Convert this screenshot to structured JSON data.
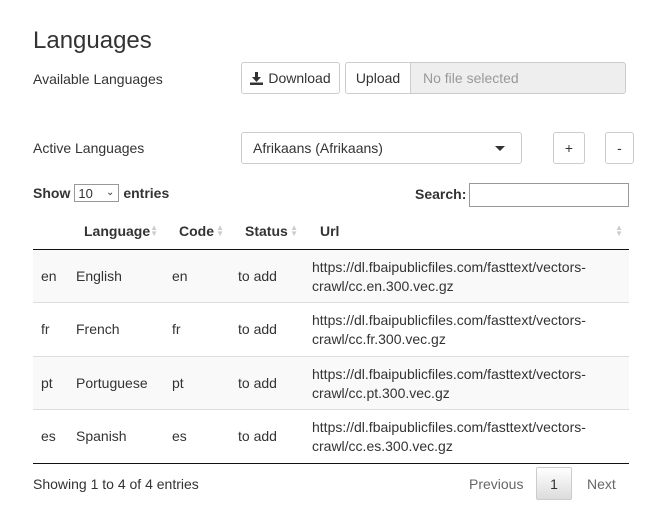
{
  "page": {
    "title": "Languages"
  },
  "available": {
    "label": "Available Languages",
    "download_label": "Download",
    "upload_label": "Upload",
    "file_placeholder": "No file selected"
  },
  "active": {
    "label": "Active Languages",
    "selected": "Afrikaans (Afrikaans)",
    "add_label": "+",
    "remove_label": "-"
  },
  "table_controls": {
    "show_label": "Show",
    "entries_label": "entries",
    "page_length": "10",
    "search_label": "Search:"
  },
  "table": {
    "columns": [
      "",
      "Language",
      "Code",
      "Status",
      "Url"
    ],
    "rows": [
      {
        "id": "en",
        "language": "English",
        "code": "en",
        "status": "to add",
        "url_1": "https://dl.fbaipublicfiles.com/fasttext/vectors-",
        "url_2": "crawl/cc.en.300.vec.gz"
      },
      {
        "id": "fr",
        "language": "French",
        "code": "fr",
        "status": "to add",
        "url_1": "https://dl.fbaipublicfiles.com/fasttext/vectors-",
        "url_2": "crawl/cc.fr.300.vec.gz"
      },
      {
        "id": "pt",
        "language": "Portuguese",
        "code": "pt",
        "status": "to add",
        "url_1": "https://dl.fbaipublicfiles.com/fasttext/vectors-",
        "url_2": "crawl/cc.pt.300.vec.gz"
      },
      {
        "id": "es",
        "language": "Spanish",
        "code": "es",
        "status": "to add",
        "url_1": "https://dl.fbaipublicfiles.com/fasttext/vectors-",
        "url_2": "crawl/cc.es.300.vec.gz"
      }
    ]
  },
  "footer": {
    "info": "Showing 1 to 4 of 4 entries",
    "previous": "Previous",
    "current_page": "1",
    "next": "Next"
  }
}
